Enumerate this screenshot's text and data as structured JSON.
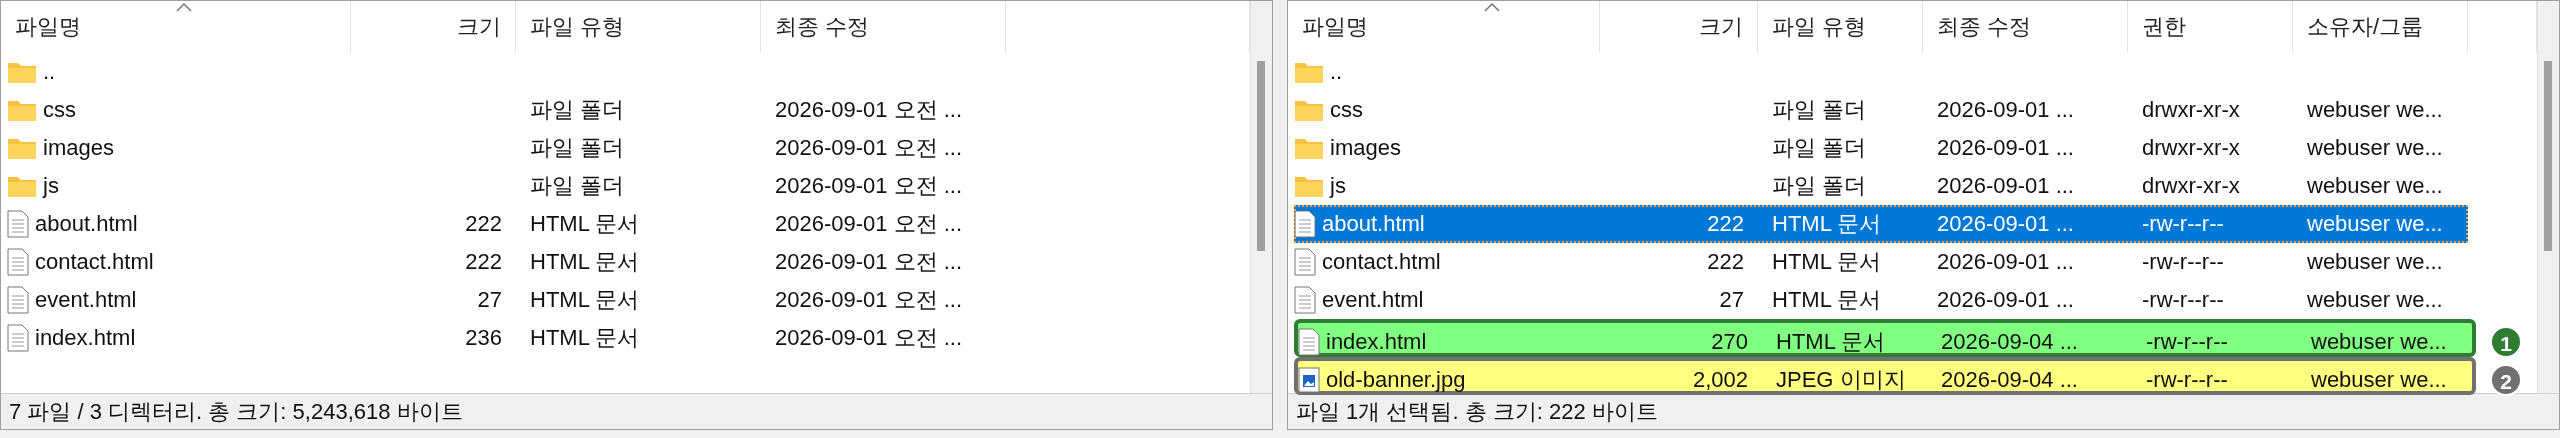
{
  "panes": [
    {
      "columns": [
        "파일명",
        "크기",
        "파일 유형",
        "최종 수정"
      ],
      "rows": [
        {
          "kind": "folder",
          "selected": false,
          "cells": [
            "..",
            "",
            "",
            ""
          ]
        },
        {
          "kind": "folder",
          "selected": false,
          "cells": [
            "css",
            "",
            "파일 폴더",
            "2026-09-01 오전 ..."
          ]
        },
        {
          "kind": "folder",
          "selected": false,
          "cells": [
            "images",
            "",
            "파일 폴더",
            "2026-09-01 오전 ..."
          ]
        },
        {
          "kind": "folder",
          "selected": false,
          "cells": [
            "js",
            "",
            "파일 폴더",
            "2026-09-01 오전 ..."
          ]
        },
        {
          "kind": "document",
          "selected": false,
          "cells": [
            "about.html",
            "222",
            "HTML 문서",
            "2026-09-01 오전 ..."
          ]
        },
        {
          "kind": "document",
          "selected": false,
          "cells": [
            "contact.html",
            "222",
            "HTML 문서",
            "2026-09-01 오전 ..."
          ]
        },
        {
          "kind": "document",
          "selected": false,
          "cells": [
            "event.html",
            "27",
            "HTML 문서",
            "2026-09-01 오전 ..."
          ]
        },
        {
          "kind": "document",
          "selected": false,
          "cells": [
            "index.html",
            "236",
            "HTML 문서",
            "2026-09-01 오전 ..."
          ]
        }
      ],
      "status": "7 파일 / 3 디렉터리. 총 크기: 5,243,618 바이트"
    },
    {
      "columns": [
        "파일명",
        "크기",
        "파일 유형",
        "최종 수정",
        "권한",
        "소유자/그룹"
      ],
      "rows": [
        {
          "kind": "folder",
          "selected": false,
          "cells": [
            "..",
            "",
            "",
            "",
            "",
            ""
          ]
        },
        {
          "kind": "folder",
          "selected": false,
          "cells": [
            "css",
            "",
            "파일 폴더",
            "2026-09-01 ...",
            "drwxr-xr-x",
            "webuser we..."
          ]
        },
        {
          "kind": "folder",
          "selected": false,
          "cells": [
            "images",
            "",
            "파일 폴더",
            "2026-09-01 ...",
            "drwxr-xr-x",
            "webuser we..."
          ]
        },
        {
          "kind": "folder",
          "selected": false,
          "cells": [
            "js",
            "",
            "파일 폴더",
            "2026-09-01 ...",
            "drwxr-xr-x",
            "webuser we..."
          ]
        },
        {
          "kind": "document",
          "selected": true,
          "cells": [
            "about.html",
            "222",
            "HTML 문서",
            "2026-09-01 ...",
            "-rw-r--r--",
            "webuser we..."
          ]
        },
        {
          "kind": "document",
          "selected": false,
          "cells": [
            "contact.html",
            "222",
            "HTML 문서",
            "2026-09-01 ...",
            "-rw-r--r--",
            "webuser we..."
          ]
        },
        {
          "kind": "document",
          "selected": false,
          "cells": [
            "event.html",
            "27",
            "HTML 문서",
            "2026-09-01 ...",
            "-rw-r--r--",
            "webuser we..."
          ]
        },
        {
          "kind": "document",
          "selected": false,
          "cells": [
            "index.html",
            "270",
            "HTML 문서",
            "2026-09-04 ...",
            "-rw-r--r--",
            "webuser we..."
          ],
          "annotation": {
            "number": "1",
            "kind": "added",
            "color": "#80ff80"
          }
        },
        {
          "kind": "image",
          "selected": false,
          "cells": [
            "old-banner.jpg",
            "2,002",
            "JPEG 이미지",
            "2026-09-04 ...",
            "-rw-r--r--",
            "webuser we..."
          ],
          "annotation": {
            "number": "2",
            "kind": "removed",
            "color": "#ffff80"
          }
        }
      ],
      "status": "파일 1개 선택됨. 총 크기: 222 바이트"
    }
  ]
}
